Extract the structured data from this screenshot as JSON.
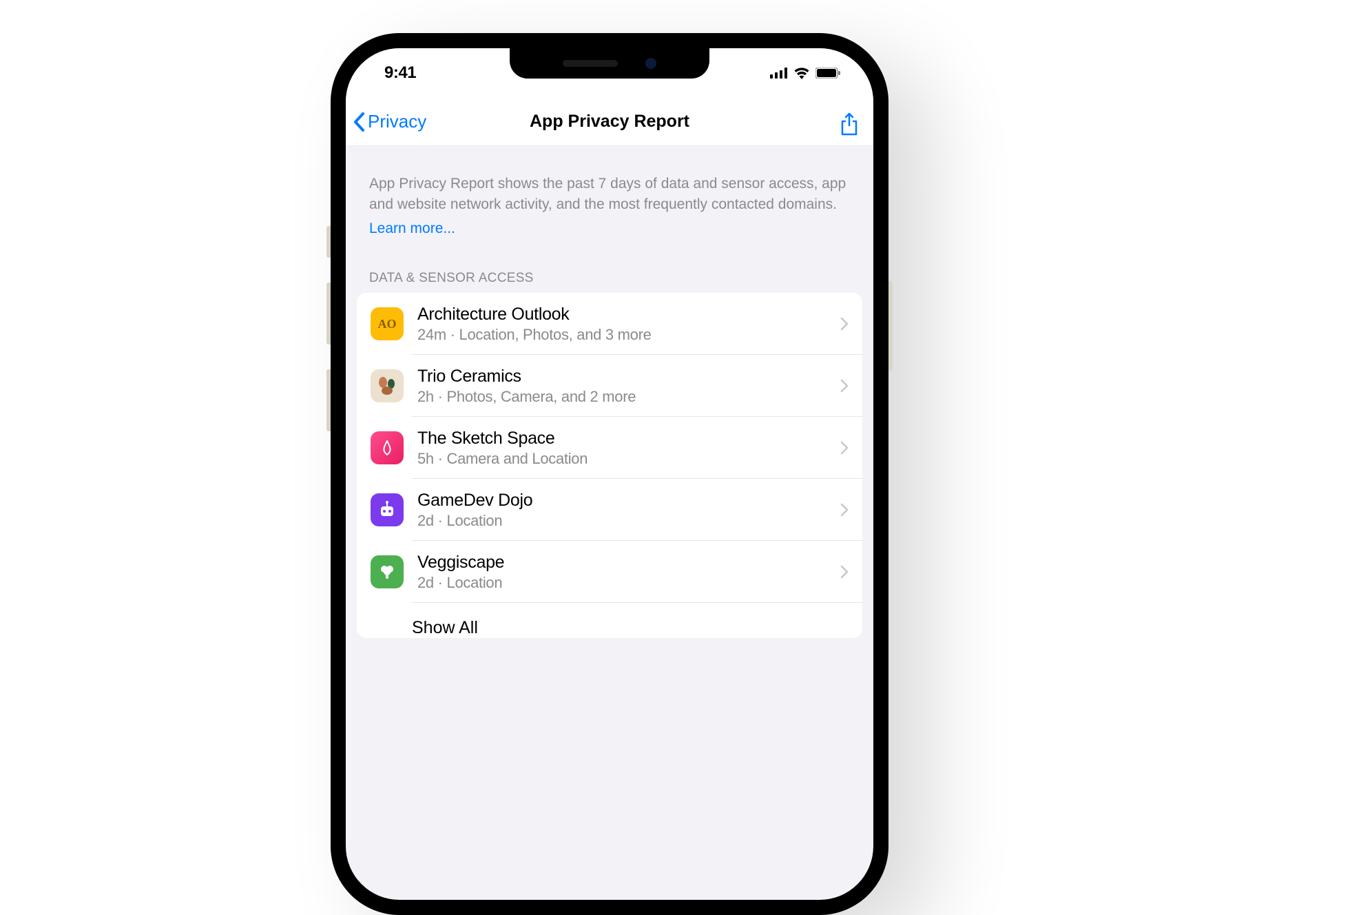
{
  "status": {
    "time": "9:41"
  },
  "nav": {
    "back_label": "Privacy",
    "title": "App Privacy Report"
  },
  "intro": {
    "text": "App Privacy Report shows the past 7 days of data and sensor access, app and website network activity, and the most frequently contacted domains.",
    "learn_more": "Learn more..."
  },
  "section": {
    "header": "DATA & SENSOR ACCESS"
  },
  "apps": [
    {
      "name": "Architecture Outlook",
      "sub": "24m · Location, Photos, and 3 more",
      "icon_text": "AO"
    },
    {
      "name": "Trio Ceramics",
      "sub": "2h · Photos, Camera, and 2 more",
      "icon_text": ""
    },
    {
      "name": "The Sketch Space",
      "sub": "5h · Camera and Location",
      "icon_text": ""
    },
    {
      "name": "GameDev Dojo",
      "sub": "2d · Location",
      "icon_text": ""
    },
    {
      "name": "Veggiscape",
      "sub": "2d · Location",
      "icon_text": ""
    }
  ],
  "show_all": "Show All"
}
